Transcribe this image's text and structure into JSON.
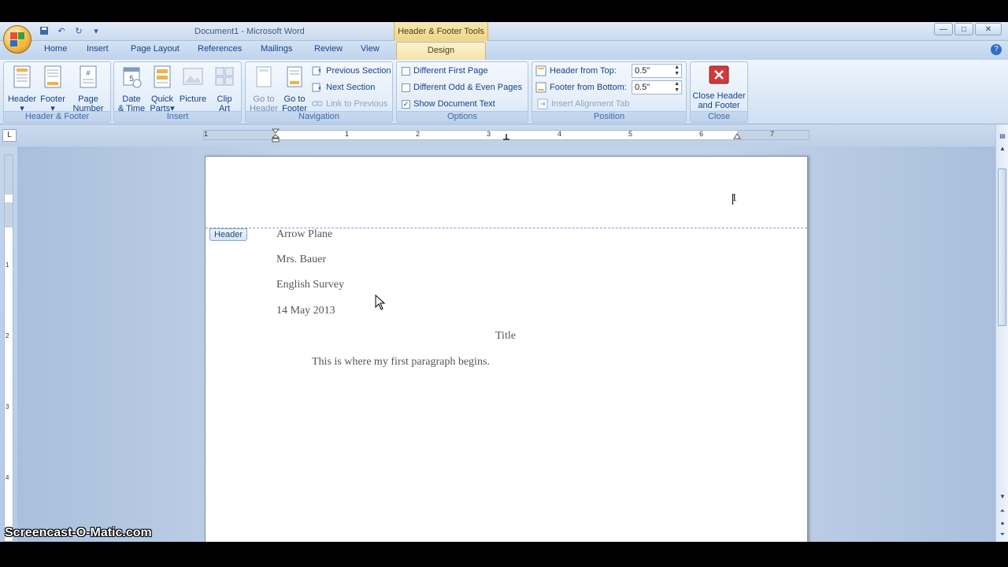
{
  "window": {
    "doc_title": "Document1 - Microsoft Word",
    "contextual_title": "Header & Footer Tools",
    "controls": [
      "—",
      "□",
      "✕"
    ]
  },
  "tabs": {
    "home": "Home",
    "insert": "Insert",
    "page_layout": "Page Layout",
    "references": "References",
    "mailings": "Mailings",
    "review": "Review",
    "view": "View",
    "design": "Design"
  },
  "ribbon": {
    "header_footer": {
      "label": "Header & Footer",
      "header": "Header",
      "footer": "Footer",
      "page_number_1": "Page",
      "page_number_2": "Number"
    },
    "insert": {
      "label": "Insert",
      "date_1": "Date",
      "date_2": "& Time",
      "quick_1": "Quick",
      "quick_2": "Parts",
      "picture": "Picture",
      "clip_1": "Clip",
      "clip_2": "Art"
    },
    "navigation": {
      "label": "Navigation",
      "goto_header_1": "Go to",
      "goto_header_2": "Header",
      "goto_footer_1": "Go to",
      "goto_footer_2": "Footer",
      "previous_section": "Previous Section",
      "next_section": "Next Section",
      "link_previous": "Link to Previous"
    },
    "options": {
      "label": "Options",
      "different_first": "Different First Page",
      "different_odd_even": "Different Odd & Even Pages",
      "show_document_text": "Show Document Text",
      "show_document_text_checked": true
    },
    "position": {
      "label": "Position",
      "header_from_top": "Header from Top:",
      "header_from_top_value": "0.5\"",
      "footer_from_bottom": "Footer from Bottom:",
      "footer_from_bottom_value": "0.5\"",
      "insert_alignment_tab": "Insert Alignment Tab"
    },
    "close": {
      "label": "Close",
      "close_1": "Close Header",
      "close_2": "and Footer"
    }
  },
  "ruler": {
    "tab_selector": "L",
    "numbers": [
      "1",
      "1",
      "2",
      "3",
      "4",
      "5",
      "6",
      "7"
    ],
    "v_numbers": [
      "1",
      "2",
      "3",
      "4"
    ]
  },
  "page": {
    "header_tag": "Header",
    "page_number": "1",
    "lines": {
      "name": "Arrow Plane",
      "teacher": "Mrs. Bauer",
      "course": "English Survey",
      "date": "14 May 2013",
      "title": "Title",
      "paragraph": "This is where my first paragraph begins."
    }
  },
  "watermark": "Screencast-O-Matic.com",
  "colors": {
    "accent": "#15428b",
    "contextual_tab": "#f4e3a9",
    "close_button": "#d03a3a"
  }
}
